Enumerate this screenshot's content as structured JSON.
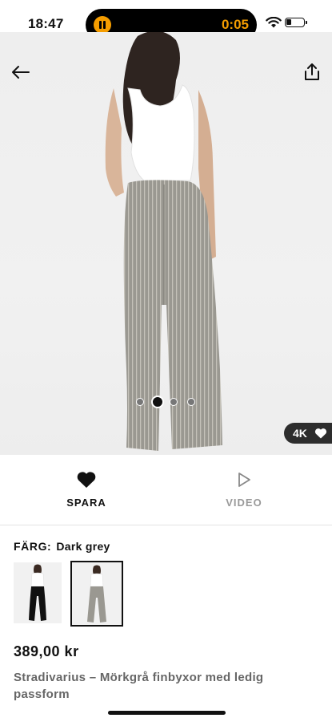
{
  "status_bar": {
    "time": "18:47",
    "recording_timer": "0:05"
  },
  "hero": {
    "badge_label": "4K",
    "pager": {
      "count": 4,
      "active_index": 1
    }
  },
  "actions": {
    "save_label": "SPARA",
    "video_label": "VIDEO"
  },
  "product": {
    "color_label": "FÄRG:",
    "color_value": "Dark grey",
    "price": "389,00 kr",
    "title": "Stradivarius – Mörkgrå finbyxor med ledig passform",
    "color_options": [
      {
        "name": "black-trousers",
        "selected": false
      },
      {
        "name": "dark-grey-trousers",
        "selected": true
      }
    ]
  },
  "colors": {
    "accent": "#f59d00",
    "text": "#111111",
    "muted": "#666666",
    "background": "#ffffff"
  }
}
